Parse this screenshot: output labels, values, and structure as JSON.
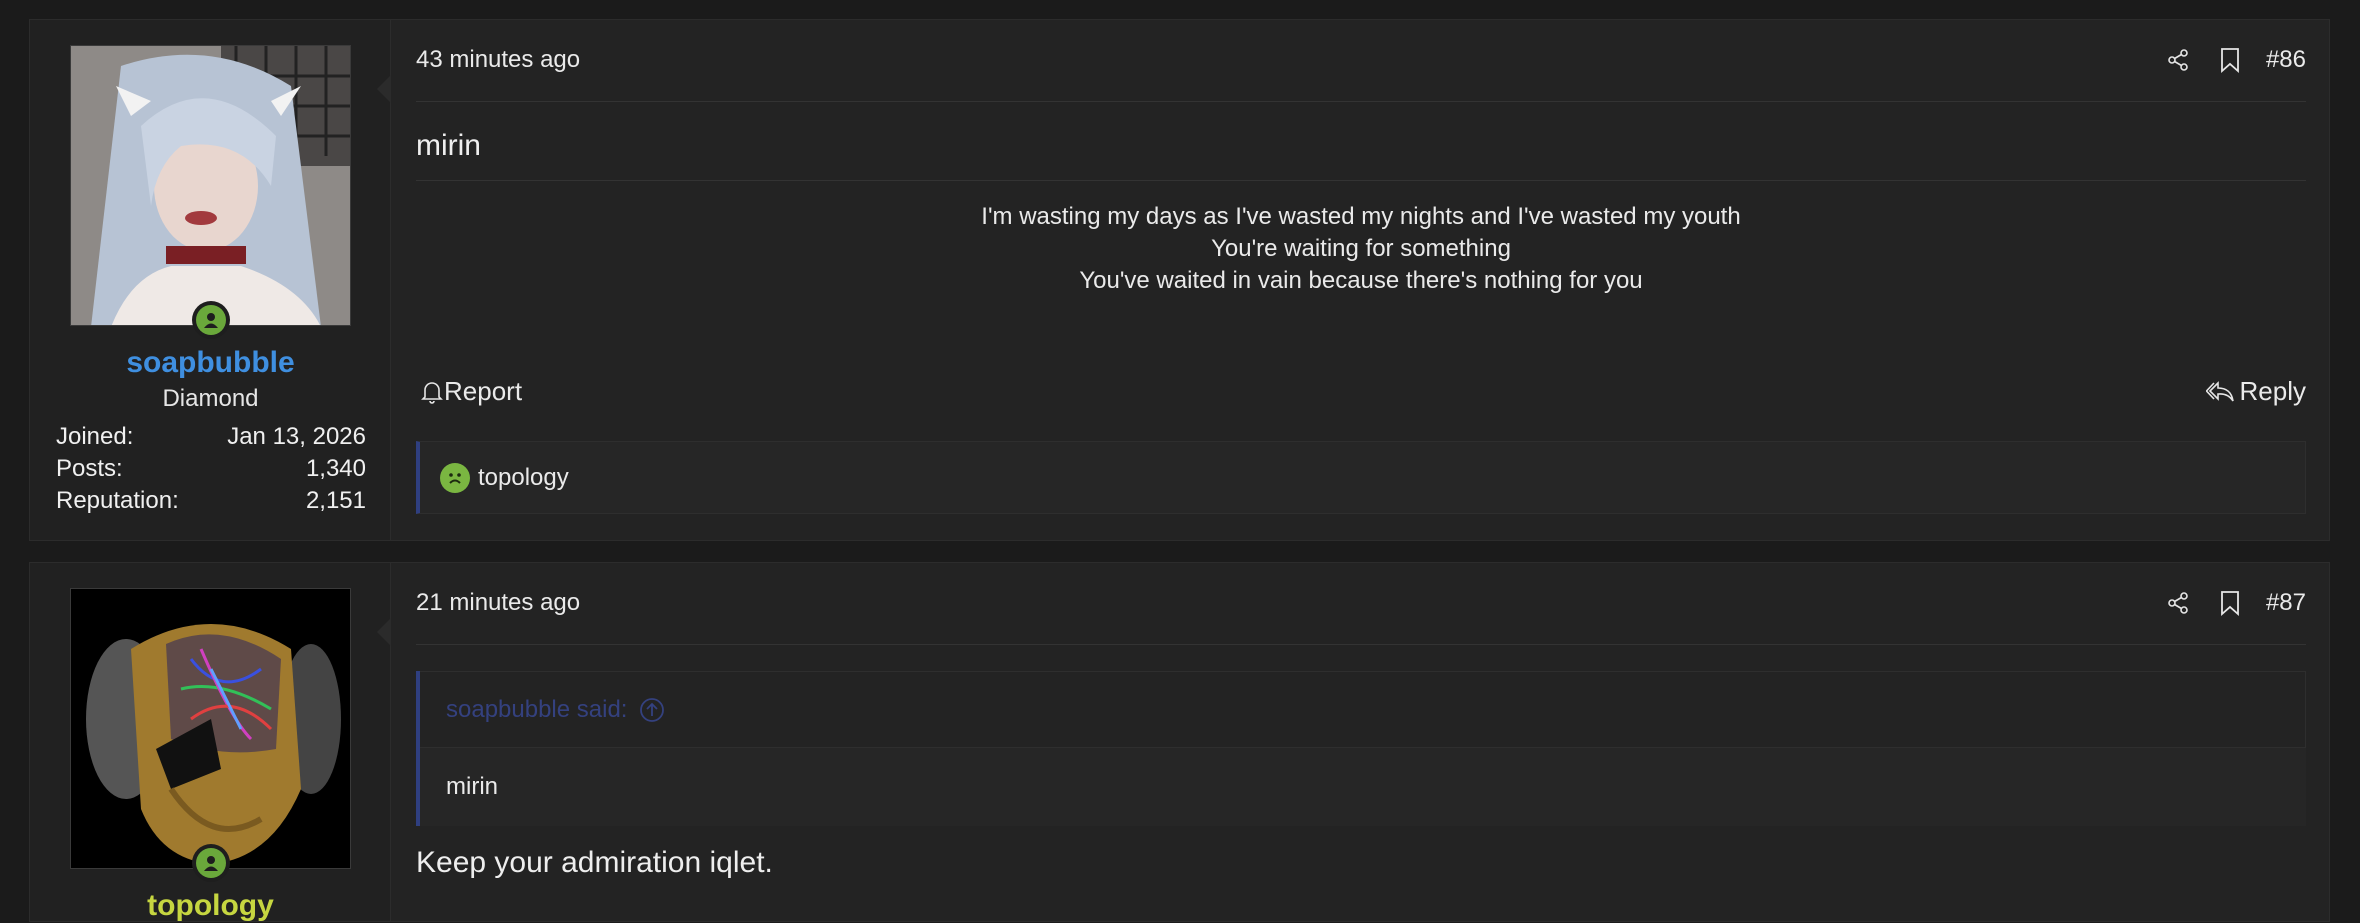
{
  "posts": [
    {
      "time": "43 minutes ago",
      "number": "#86",
      "user": {
        "name": "soapbubble",
        "title": "Diamond",
        "stats": [
          {
            "label": "Joined:",
            "value": "Jan 13, 2026"
          },
          {
            "label": "Posts:",
            "value": "1,340"
          },
          {
            "label": "Reputation:",
            "value": "2,151"
          }
        ],
        "name_color": "#3f8fe0"
      },
      "body": "mirin",
      "signature": [
        "I'm wasting my days as I've wasted my nights and I've wasted my youth",
        "You're waiting for something",
        "You've waited in vain because there's nothing for you"
      ],
      "actions": {
        "report": "Report",
        "reply": "Reply"
      },
      "reactions": {
        "users": "topology",
        "emoji_icon": "sick-face-icon"
      }
    },
    {
      "time": "21 minutes ago",
      "number": "#87",
      "user": {
        "name": "topology",
        "name_color": "#c6d640"
      },
      "quote": {
        "author": "soapbubble said:",
        "text": "mirin"
      },
      "body": "Keep your admiration iqlet."
    }
  ],
  "colors": {
    "background": "#1b1b1b",
    "panel": "#232323",
    "accent_quote": "#2f3f80",
    "online": "#6aa83b"
  }
}
